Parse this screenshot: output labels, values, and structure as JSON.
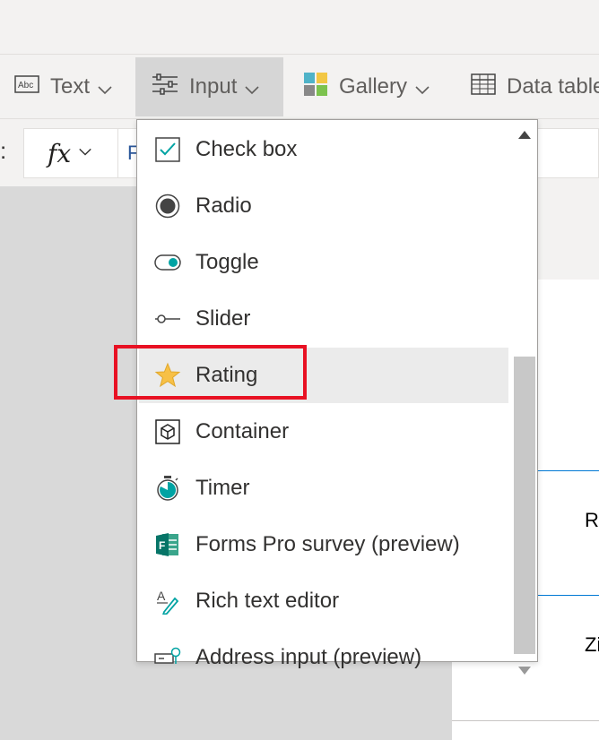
{
  "ribbon": {
    "text_label": "Text",
    "input_label": "Input",
    "gallery_label": "Gallery",
    "datatable_label": "Data table"
  },
  "formula_bar": {
    "colon": ":",
    "fx_label": "fx",
    "value_partial": "F"
  },
  "dropdown": {
    "items": [
      {
        "label": "Check box",
        "icon": "checkbox-icon"
      },
      {
        "label": "Radio",
        "icon": "radio-icon"
      },
      {
        "label": "Toggle",
        "icon": "toggle-icon"
      },
      {
        "label": "Slider",
        "icon": "slider-icon"
      },
      {
        "label": "Rating",
        "icon": "star-icon",
        "highlighted": true
      },
      {
        "label": "Container",
        "icon": "container-icon"
      },
      {
        "label": "Timer",
        "icon": "timer-icon"
      },
      {
        "label": "Forms Pro survey (preview)",
        "icon": "forms-icon"
      },
      {
        "label": "Rich text editor",
        "icon": "rich-text-icon"
      },
      {
        "label": "Address input (preview)",
        "icon": "address-input-icon"
      }
    ]
  },
  "canvas": {
    "right_text_1": "R",
    "right_text_2": "Zi"
  },
  "colors": {
    "accent_teal": "#00a3a3",
    "star": "#f7c046",
    "highlight_red": "#e81123",
    "forms_green": "#077568"
  }
}
